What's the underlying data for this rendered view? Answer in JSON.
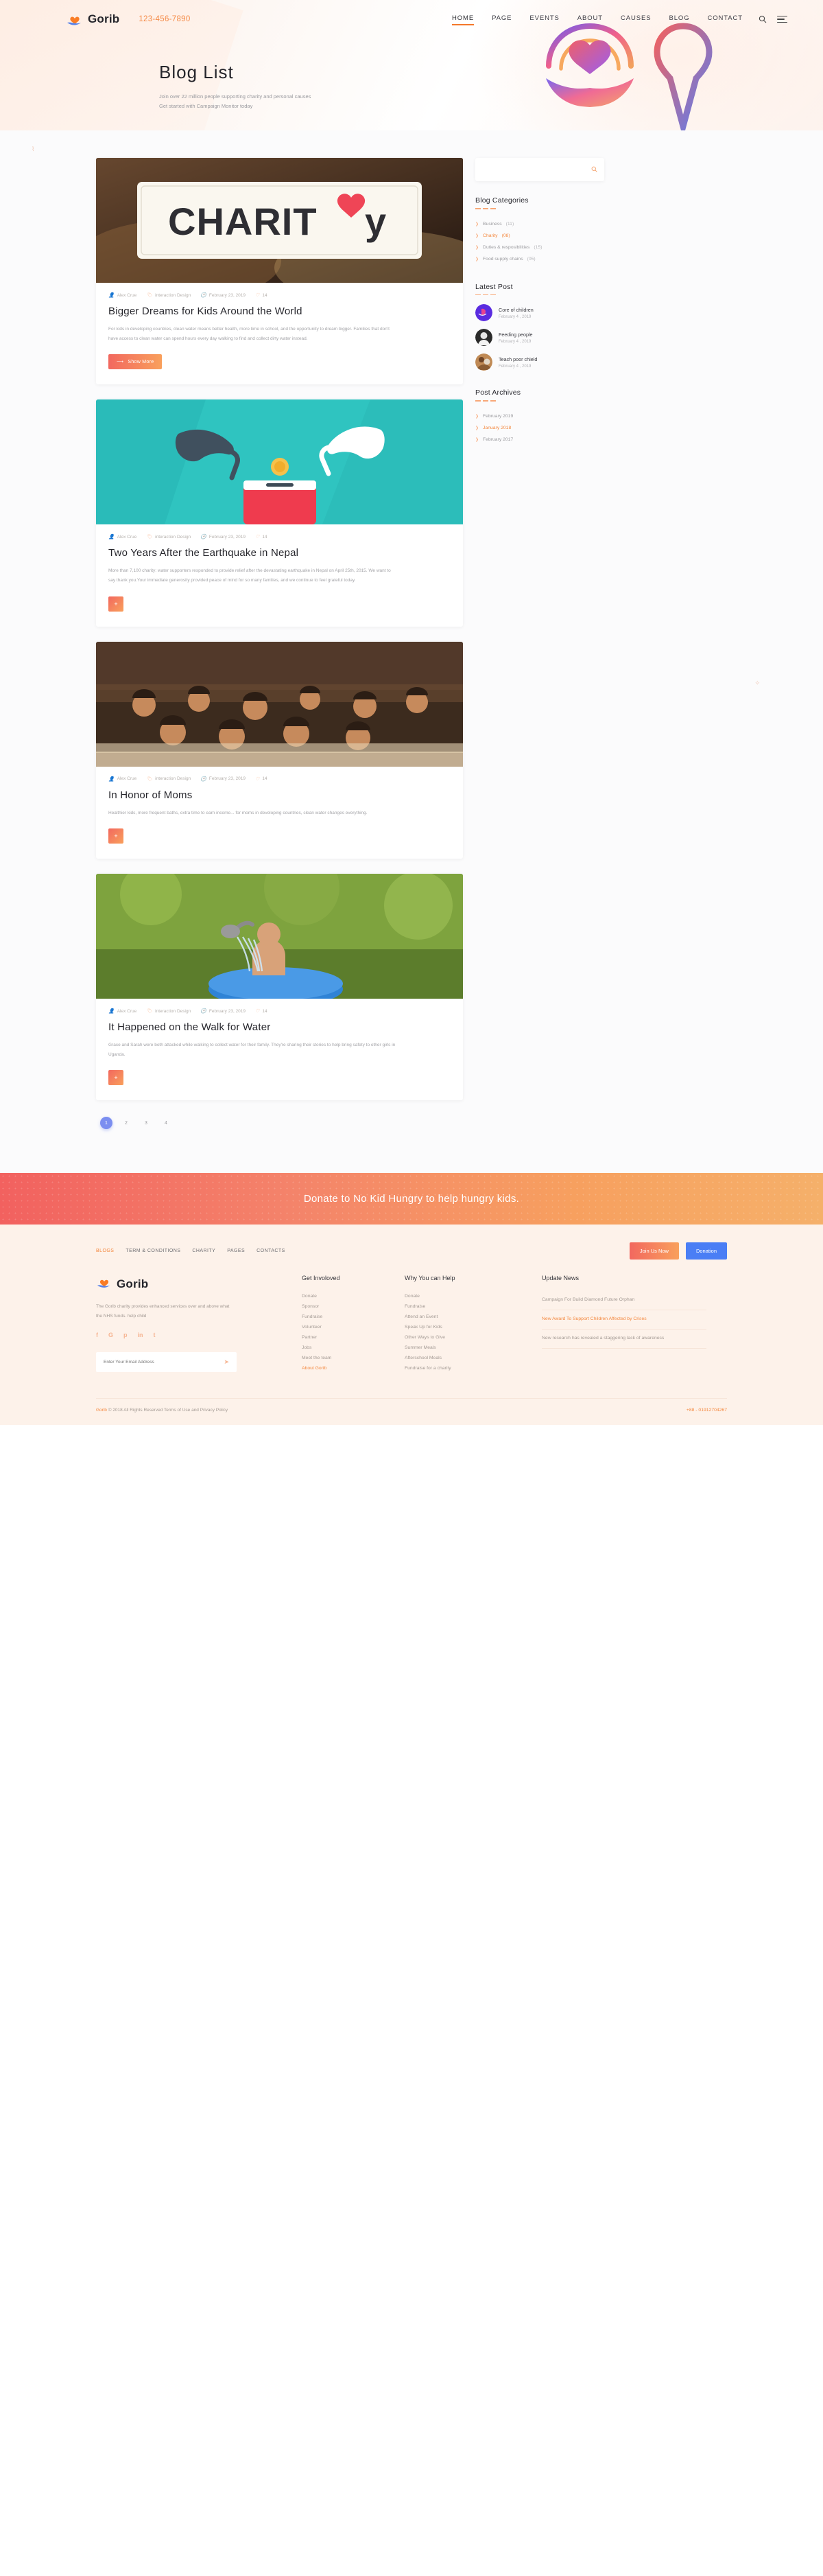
{
  "brand": {
    "name": "Gorib",
    "phone": "123-456-7890",
    "logo_icon": "heart-hand-icon"
  },
  "nav": {
    "items": [
      {
        "label": "HOME",
        "active": true
      },
      {
        "label": "PAGE",
        "active": false
      },
      {
        "label": "EVENTS",
        "active": false
      },
      {
        "label": "ABOUT",
        "active": false
      },
      {
        "label": "CAUSES",
        "active": false
      },
      {
        "label": "BLOG",
        "active": false
      },
      {
        "label": "CONTACT",
        "active": false
      }
    ],
    "search_icon": "search-icon",
    "menu_icon": "hamburger-menu-icon"
  },
  "hero": {
    "title": "Blog  List",
    "subtitle_line1": "Join over 22 million people supporting charity and personal causes",
    "subtitle_line2": "Get started with Campaign Monitor today"
  },
  "sidebar": {
    "search_placeholder": "",
    "categories_title": "Blog Categories",
    "categories": [
      {
        "label": "Business",
        "count": "(11)",
        "active": false
      },
      {
        "label": "Charity",
        "count": "(08)",
        "active": true
      },
      {
        "label": "Duties & resposibilities",
        "count": "(15)",
        "active": false
      },
      {
        "label": "Food supply chains",
        "count": "(05)",
        "active": false
      }
    ],
    "latest_title": "Latest Post",
    "latest": [
      {
        "name": "Core of children",
        "date": "February 4 , 2019"
      },
      {
        "name": "Feeding people",
        "date": "February 4 , 2019"
      },
      {
        "name": "Teach poor chield",
        "date": "February 4 , 2019"
      }
    ],
    "archives_title": "Post Archives",
    "archives": [
      {
        "label": "February 2019",
        "active": false
      },
      {
        "label": "January 2018",
        "active": true
      },
      {
        "label": "February 2017",
        "active": false
      }
    ]
  },
  "posts": [
    {
      "author": "Alex Crue",
      "category": "interaction Design",
      "date": "February 23, 2019",
      "comments": "14",
      "title": "Bigger Dreams for Kids Around the World",
      "text": "For kids in developing countries, clean water means better health, more time in school, and the opportunity to dream bigger. Families that don't have access to clean water can spend hours every day walking to find and collect dirty water instead.",
      "button": "Show More",
      "button_type": "wide",
      "image": "charity-jar-photo"
    },
    {
      "author": "Alex Crue",
      "category": "interaction Design",
      "date": "February 23, 2019",
      "comments": "14",
      "title": "Two Years After the Earthquake in Nepal",
      "text": "More than 7,100 charity: water supporters responded to provide relief after the devastating earthquake in Nepal on April 25th, 2015. We want to say thank you.Your immediate generosity provided peace of mind for so many families, and we continue to feel grateful today.",
      "button": "+",
      "button_type": "icon",
      "image": "donation-coin-illustration"
    },
    {
      "author": "Alex Crue",
      "category": "interaction Design",
      "date": "February 23, 2019",
      "comments": "14",
      "title": "In Honor of Moms",
      "text": "Healthier kids, more frequent baths, extra time to earn income... for moms in developing countries, clean water changes everything.",
      "button": "+",
      "button_type": "icon",
      "image": "classroom-children-photo"
    },
    {
      "author": "Alex Crue",
      "category": "interaction Design",
      "date": "February 23, 2019",
      "comments": "14",
      "title": "It Happened on the Walk for Water",
      "text": "Grace and Sarah were both attacked while walking to collect water for their family. They're sharing their stories to help bring safety to other girls in Uganda.",
      "button": "+",
      "button_type": "icon",
      "image": "child-bathing-photo"
    }
  ],
  "pagination": {
    "pages": [
      "1",
      "2",
      "3",
      "4"
    ],
    "active": "1"
  },
  "donate_banner": {
    "text": "Donate to No Kid Hungry to help hungry kids."
  },
  "footer": {
    "nav": [
      {
        "label": "BLOGS",
        "active": true
      },
      {
        "label": "TERM & CONDITIONS",
        "active": false
      },
      {
        "label": "CHARITY",
        "active": false
      },
      {
        "label": "PAGES",
        "active": false
      },
      {
        "label": "CONTACTS",
        "active": false
      }
    ],
    "join_button": "Join Us Now",
    "donation_button": "Donation",
    "brand_name": "Gorib",
    "description": "The Gorib charity provides enhanced services over and above what the NHS funds. help child",
    "social": [
      "f",
      "G",
      "p",
      "in",
      "t"
    ],
    "email_placeholder": "Enter Your Email Address",
    "send_icon": "paper-plane-icon",
    "col_get_involved": {
      "title": "Get Involoved",
      "links": [
        {
          "label": "Donate",
          "active": false
        },
        {
          "label": "Sponsor",
          "active": false
        },
        {
          "label": "Fundraise",
          "active": false
        },
        {
          "label": "Volunteer",
          "active": false
        },
        {
          "label": "Partner",
          "active": false
        },
        {
          "label": "Jobs",
          "active": false
        },
        {
          "label": "Meet the team",
          "active": false
        },
        {
          "label": "About Gorib",
          "active": true
        }
      ]
    },
    "col_why_help": {
      "title": "Why You can Help",
      "links": [
        {
          "label": "Donate",
          "active": false
        },
        {
          "label": "Fundraise",
          "active": false
        },
        {
          "label": "Attend an Event",
          "active": false
        },
        {
          "label": "Speak Up for Kids",
          "active": false
        },
        {
          "label": "Other Ways to Give",
          "active": false
        },
        {
          "label": "Summer Meals",
          "active": false
        },
        {
          "label": "Afterschool Meals",
          "active": false
        },
        {
          "label": "Fundraise for a charity",
          "active": false
        }
      ]
    },
    "col_update_news": {
      "title": "Update News",
      "items": [
        {
          "text": "Campaign For Build Diamond Future Orphan",
          "active": false
        },
        {
          "text": "New Award To Support Children Affected by Crises",
          "active": true
        },
        {
          "text": "New research has revealed a staggering lack of awareness",
          "active": false
        }
      ]
    },
    "copyright_brand": "Gorib",
    "copyright_text": "© 2018 All Rights Reserved Terms of Use and Privacy Policy",
    "phone": "+88 - 01912704267"
  },
  "colors": {
    "accent_orange": "#f4883f",
    "gradient_start": "#f2685f",
    "gradient_end": "#f9a05c",
    "blue": "#4a7ef5",
    "pager_active": "#7b8ef0",
    "footer_bg": "#fdf2ea"
  }
}
